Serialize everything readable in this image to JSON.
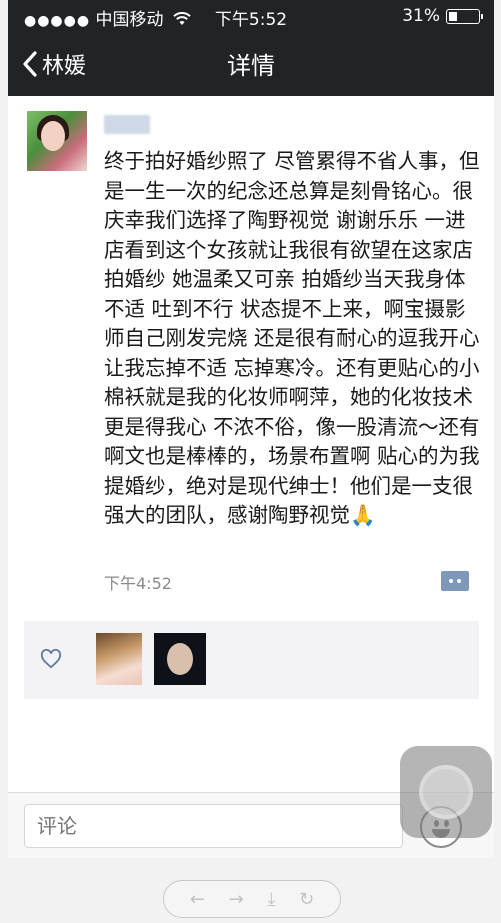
{
  "status_bar": {
    "signal_dots": "●●●●●",
    "carrier": "中国移动",
    "time": "下午5:52",
    "battery_percent_text": "31%",
    "battery_level": 0.31,
    "wifi_icon": "wifi-icon"
  },
  "nav": {
    "back_label": "林媛",
    "title": "详情"
  },
  "post": {
    "text": "终于拍好婚纱照了 尽管累得不省人事，但是一生一次的纪念还总算是刻骨铭心。很庆幸我们选择了陶野视觉 谢谢乐乐 一进店看到这个女孩就让我很有欲望在这家店拍婚纱 她温柔又可亲 拍婚纱当天我身体不适 吐到不行 状态提不上来，啊宝摄影师自己刚发完烧 还是很有耐心的逗我开心 让我忘掉不适 忘掉寒冷。还有更贴心的小棉袄就是我的化妆师啊萍，她的化妆技术更是得我心 不浓不俗，像一股清流～还有啊文也是棒棒的，场景布置啊 贴心的为我提婚纱，绝对是现代绅士！他们是一支很强大的团队，感谢陶野视觉🙏",
    "time": "下午4:52"
  },
  "comment_input": {
    "placeholder": "评论"
  },
  "toolbar": {
    "back": "←",
    "forward": "→",
    "download": "⤓",
    "refresh": "↻"
  },
  "colors": {
    "nav_bg": "#222326",
    "accent": "#7f97b9"
  }
}
